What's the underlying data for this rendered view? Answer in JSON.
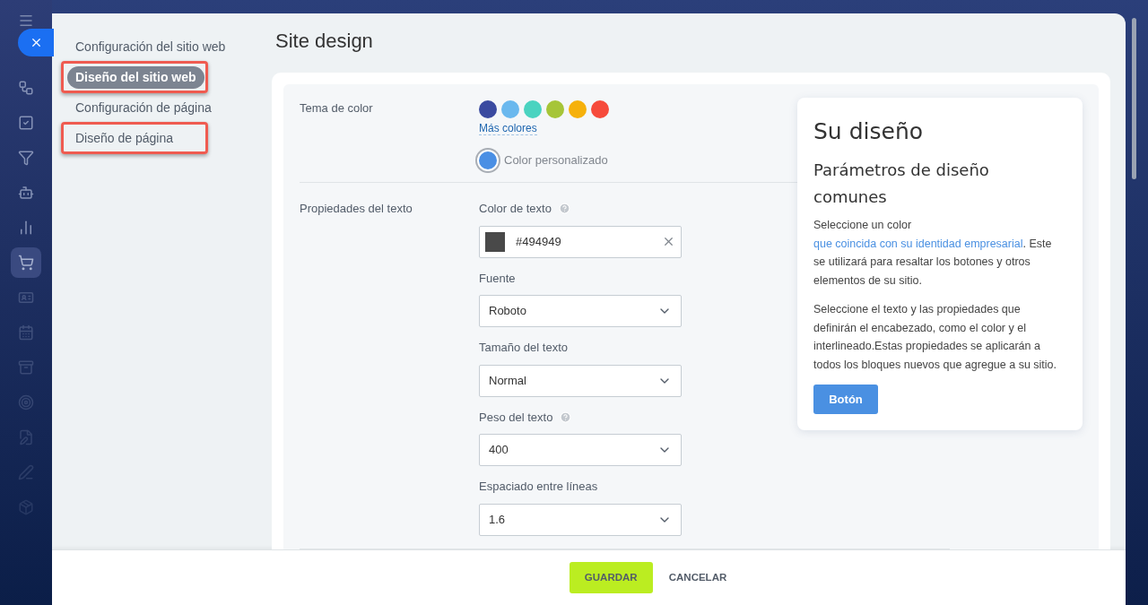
{
  "sidebar": {
    "items": [
      {
        "selected": false
      },
      {
        "selected": false
      },
      {
        "selected": false
      },
      {
        "selected": false
      },
      {
        "selected": false
      },
      {
        "selected": true
      },
      {
        "selected": false
      },
      {
        "selected": false
      },
      {
        "selected": false
      },
      {
        "selected": false
      },
      {
        "selected": false
      },
      {
        "selected": false
      },
      {
        "selected": false
      }
    ]
  },
  "nav": [
    {
      "label": "Configuración del sitio web",
      "selected": false,
      "highlighted": false
    },
    {
      "label": "Diseño del sitio web",
      "selected": true,
      "highlighted": true
    },
    {
      "label": "Configuración de página",
      "selected": false,
      "highlighted": false
    },
    {
      "label": "Diseño de página",
      "selected": false,
      "highlighted": true
    }
  ],
  "title": "Site design",
  "color_theme": {
    "label": "Tema de color",
    "swatches": [
      {
        "color": "#3a4aa0",
        "selected": false
      },
      {
        "color": "#6ab8ee",
        "selected": false
      },
      {
        "color": "#4ad3c0",
        "selected": false
      },
      {
        "color": "#a6c538",
        "selected": false
      },
      {
        "color": "#f6b10b",
        "selected": false
      },
      {
        "color": "#f64a3b",
        "selected": false
      }
    ],
    "more_link": "Más colores",
    "custom": {
      "label": "Color personalizado",
      "color": "#4a8fe4",
      "selected": true
    }
  },
  "text_props": {
    "label": "Propiedades del texto",
    "fields": [
      {
        "kind": "color",
        "label": "Color de texto",
        "help": true,
        "value": "#494949",
        "color": "#494949"
      },
      {
        "kind": "select",
        "label": "Fuente",
        "help": false,
        "value": "Roboto"
      },
      {
        "kind": "select",
        "label": "Tamaño del texto",
        "help": false,
        "value": "Normal"
      },
      {
        "kind": "select",
        "label": "Peso del texto",
        "help": true,
        "value": "400"
      },
      {
        "kind": "select",
        "label": "Espaciado entre líneas",
        "help": false,
        "value": "1.6"
      }
    ]
  },
  "preview": {
    "title": "Su diseño",
    "subtitle": "Parámetros de diseño comunes",
    "paragraph_1": {
      "before": "Seleccione un color ",
      "link": "que coincida con su identidad empresarial",
      "after": ". Este se utilizará para resaltar los botones y otros elementos de su sitio."
    },
    "paragraph_2": "Seleccione el texto y las propiedades que definirán el encabezado, como el color y el interlineado.Estas propiedades se aplicarán a todos los bloques nuevos que agregue a su sitio.",
    "button": "Botón"
  },
  "footer": {
    "save": "GUARDAR",
    "cancel": "CANCELAR"
  }
}
